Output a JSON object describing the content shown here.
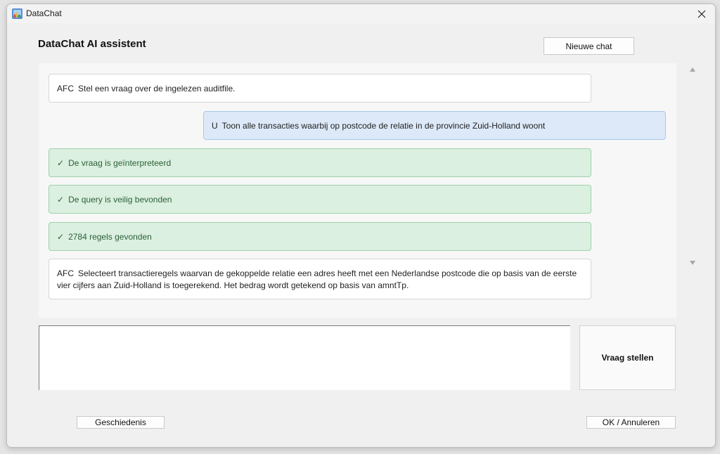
{
  "window": {
    "title": "DataChat",
    "icon": "app-icon"
  },
  "header": {
    "heading": "DataChat AI assistent",
    "new_chat_label": "Nieuwe chat"
  },
  "messages": [
    {
      "type": "ai",
      "sender": "AFC",
      "text": "Stel een vraag over de ingelezen auditfile."
    },
    {
      "type": "user",
      "sender": "U",
      "text": "Toon alle transacties waarbij op postcode de relatie in de provincie Zuid-Holland woont"
    },
    {
      "type": "status",
      "sender": "✓",
      "text": "De vraag is geïnterpreteerd"
    },
    {
      "type": "status",
      "sender": "✓",
      "text": "De query is veilig bevonden"
    },
    {
      "type": "status",
      "sender": "✓",
      "text": "2784 regels gevonden"
    },
    {
      "type": "ai",
      "sender": "AFC",
      "text": "Selecteert transactieregels waarvan de gekoppelde relatie een adres heeft met een Nederlandse postcode die op basis van de eerste vier cijfers aan Zuid-Holland is toegerekend. Het bedrag wordt getekend op basis van amntTp."
    }
  ],
  "input": {
    "value": "",
    "placeholder": ""
  },
  "ask_button_label": "Vraag stellen",
  "footer": {
    "history_label": "Geschiedenis",
    "ok_cancel_label": "OK / Annuleren"
  },
  "colors": {
    "user_bubble": "#dde9f8",
    "status_bubble": "#dbf0e0",
    "status_text": "#2b5f38"
  }
}
